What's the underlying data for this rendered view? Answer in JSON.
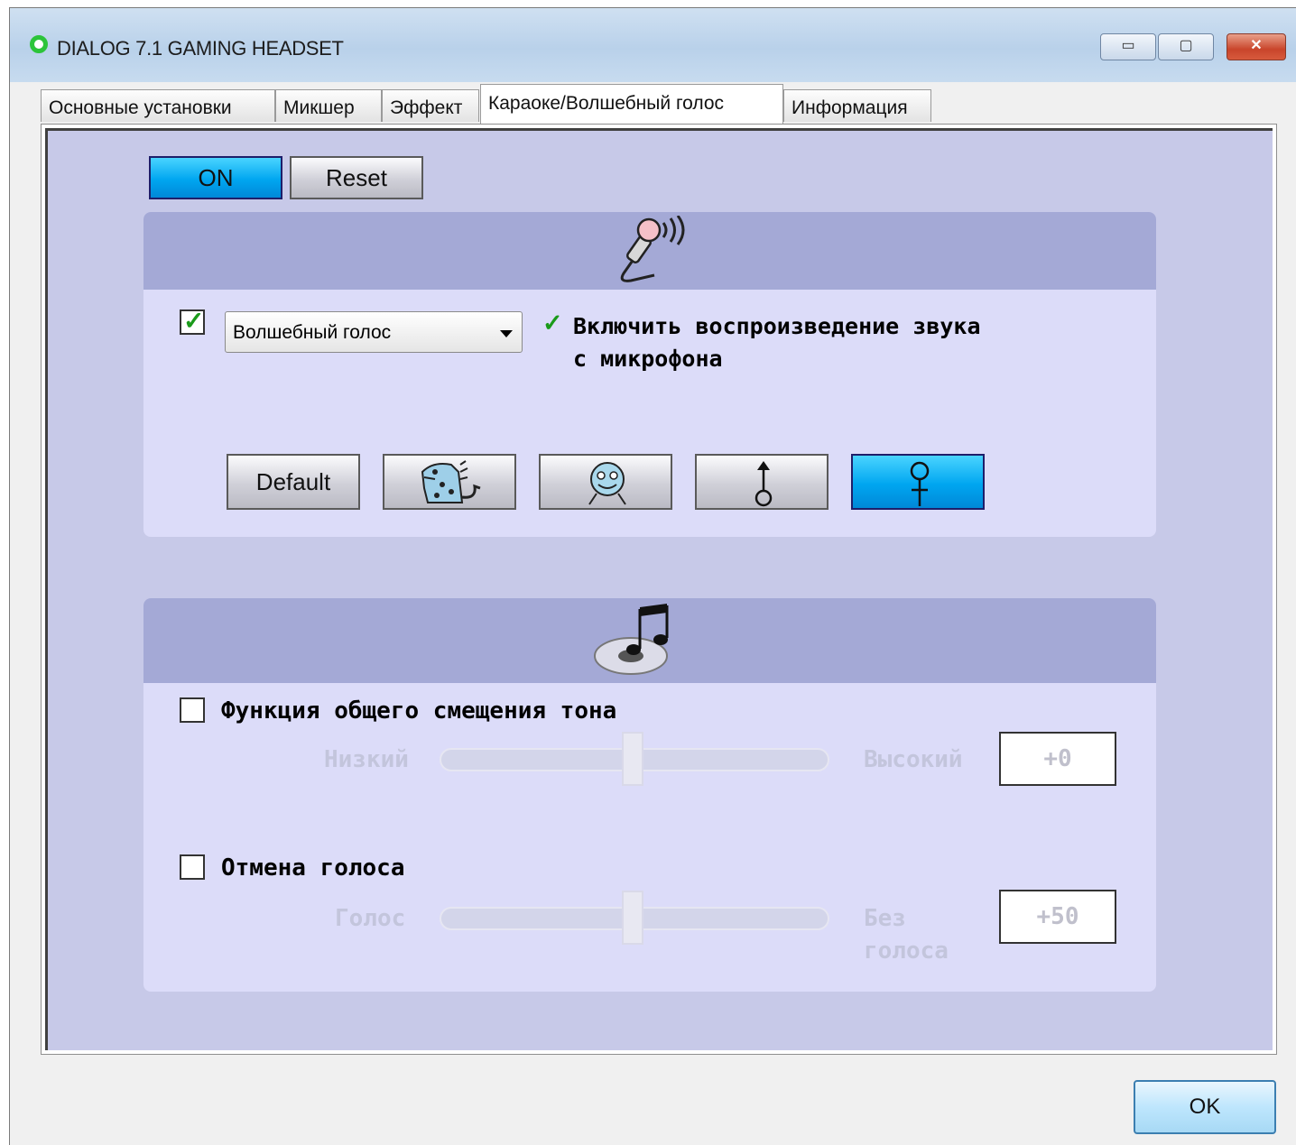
{
  "window": {
    "title": "DIALOG 7.1 GAMING HEADSET",
    "controls": {
      "minimize": "▭",
      "maximize": "▢",
      "close": "✕"
    }
  },
  "tabs": [
    {
      "label": "Основные установки"
    },
    {
      "label": "Микшер"
    },
    {
      "label": "Эффект"
    },
    {
      "label": "Караоке/Волшебный голос",
      "active": true
    },
    {
      "label": "Информация"
    }
  ],
  "toolbar": {
    "on_label": "ON",
    "reset_label": "Reset"
  },
  "magic_voice": {
    "header_icon": "microphone-icon",
    "enabled": true,
    "combo_value": "Волшебный голос",
    "playback_line1": "Включить воспроизведение звука",
    "playback_line2": "с микрофона",
    "playback_checked": true,
    "presets": [
      {
        "label": "Default",
        "icon": ""
      },
      {
        "label": "",
        "icon": "monster-icon"
      },
      {
        "label": "",
        "icon": "cartoon-face-icon"
      },
      {
        "label": "",
        "icon": "male-symbol-icon"
      },
      {
        "label": "",
        "icon": "female-symbol-icon",
        "selected": true
      }
    ]
  },
  "karaoke": {
    "header_icon": "music-disc-icon",
    "pitch": {
      "label": "Функция общего смещения тона",
      "checked": false,
      "low_label": "Низкий",
      "high_label": "Высокий",
      "value": "+0"
    },
    "vocal": {
      "label": "Отмена голоса",
      "checked": false,
      "low_label": "Голос",
      "high_label_line1": "Без",
      "high_label_line2": "голоса",
      "value": "+50"
    }
  },
  "footer": {
    "ok_label": "OK"
  }
}
